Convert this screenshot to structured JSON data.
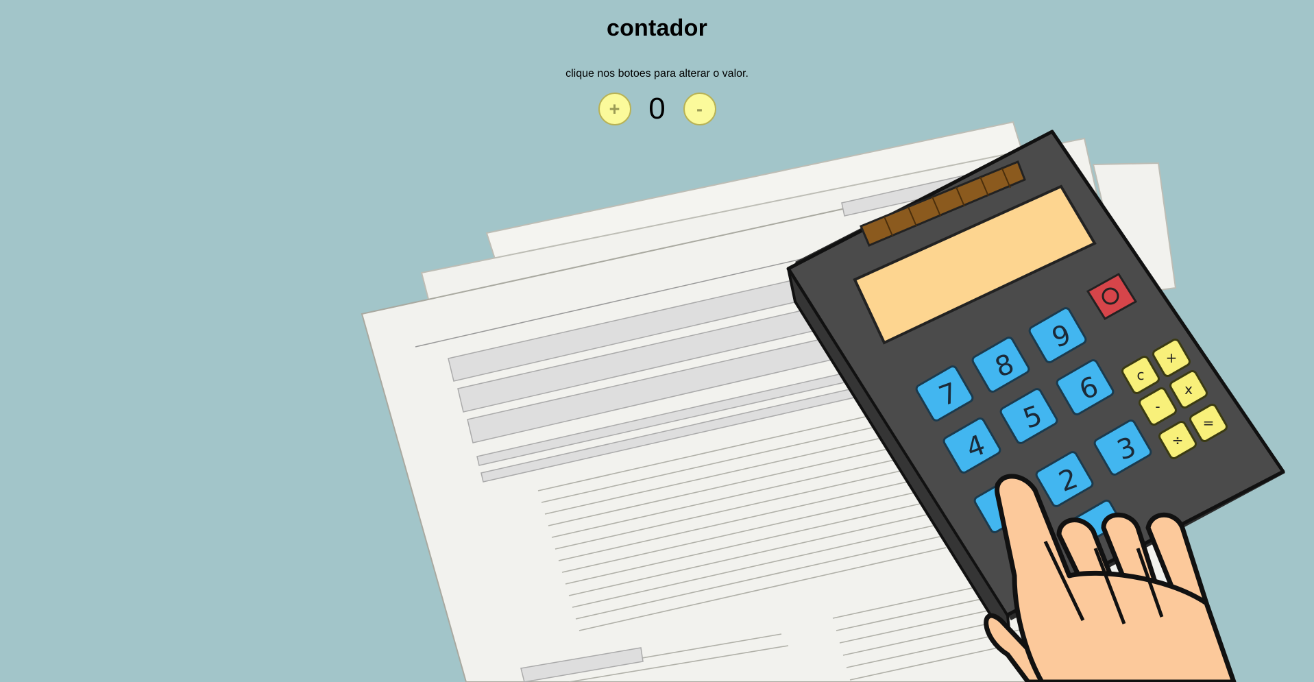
{
  "page": {
    "title": "contador",
    "instructions": "clique nos botoes para alterar o valor."
  },
  "counter": {
    "increment_label": "+",
    "value": "0",
    "decrement_label": "-"
  },
  "illustration": {
    "calculator_keys": [
      "7",
      "8",
      "9",
      "4",
      "5",
      "6",
      "2",
      "3",
      "c",
      "+",
      "-",
      "x",
      "÷",
      "="
    ],
    "colors": {
      "background": "#a2c5c9",
      "paper": "#f2f2ee",
      "calculator_body": "#4a4a4a",
      "screen": "#fdd590",
      "number_keys": "#42b6f0",
      "operator_keys": "#f8f07a",
      "power_key": "#d6454a",
      "hand": "#fcc99b",
      "button_fill": "#fbfa9b"
    }
  }
}
